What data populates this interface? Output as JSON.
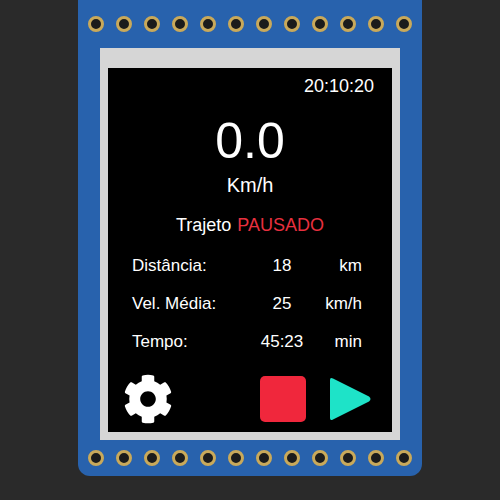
{
  "clock": "20:10:20",
  "speed": {
    "value": "0.0",
    "unit": "Km/h"
  },
  "status": {
    "label": "Trajeto",
    "state": "PAUSADO",
    "color": "#e8303f"
  },
  "stats": [
    {
      "label": "Distância:",
      "value": "18",
      "unit": "km"
    },
    {
      "label": "Vel. Média:",
      "value": "25",
      "unit": "km/h"
    },
    {
      "label": "Tempo:",
      "value": "45:23",
      "unit": "min"
    }
  ],
  "controls": [
    {
      "kind": "settings",
      "color": "#ffffff"
    },
    {
      "kind": "stop",
      "color": "#f0273c"
    },
    {
      "kind": "play",
      "color": "#1ee3c8"
    }
  ]
}
